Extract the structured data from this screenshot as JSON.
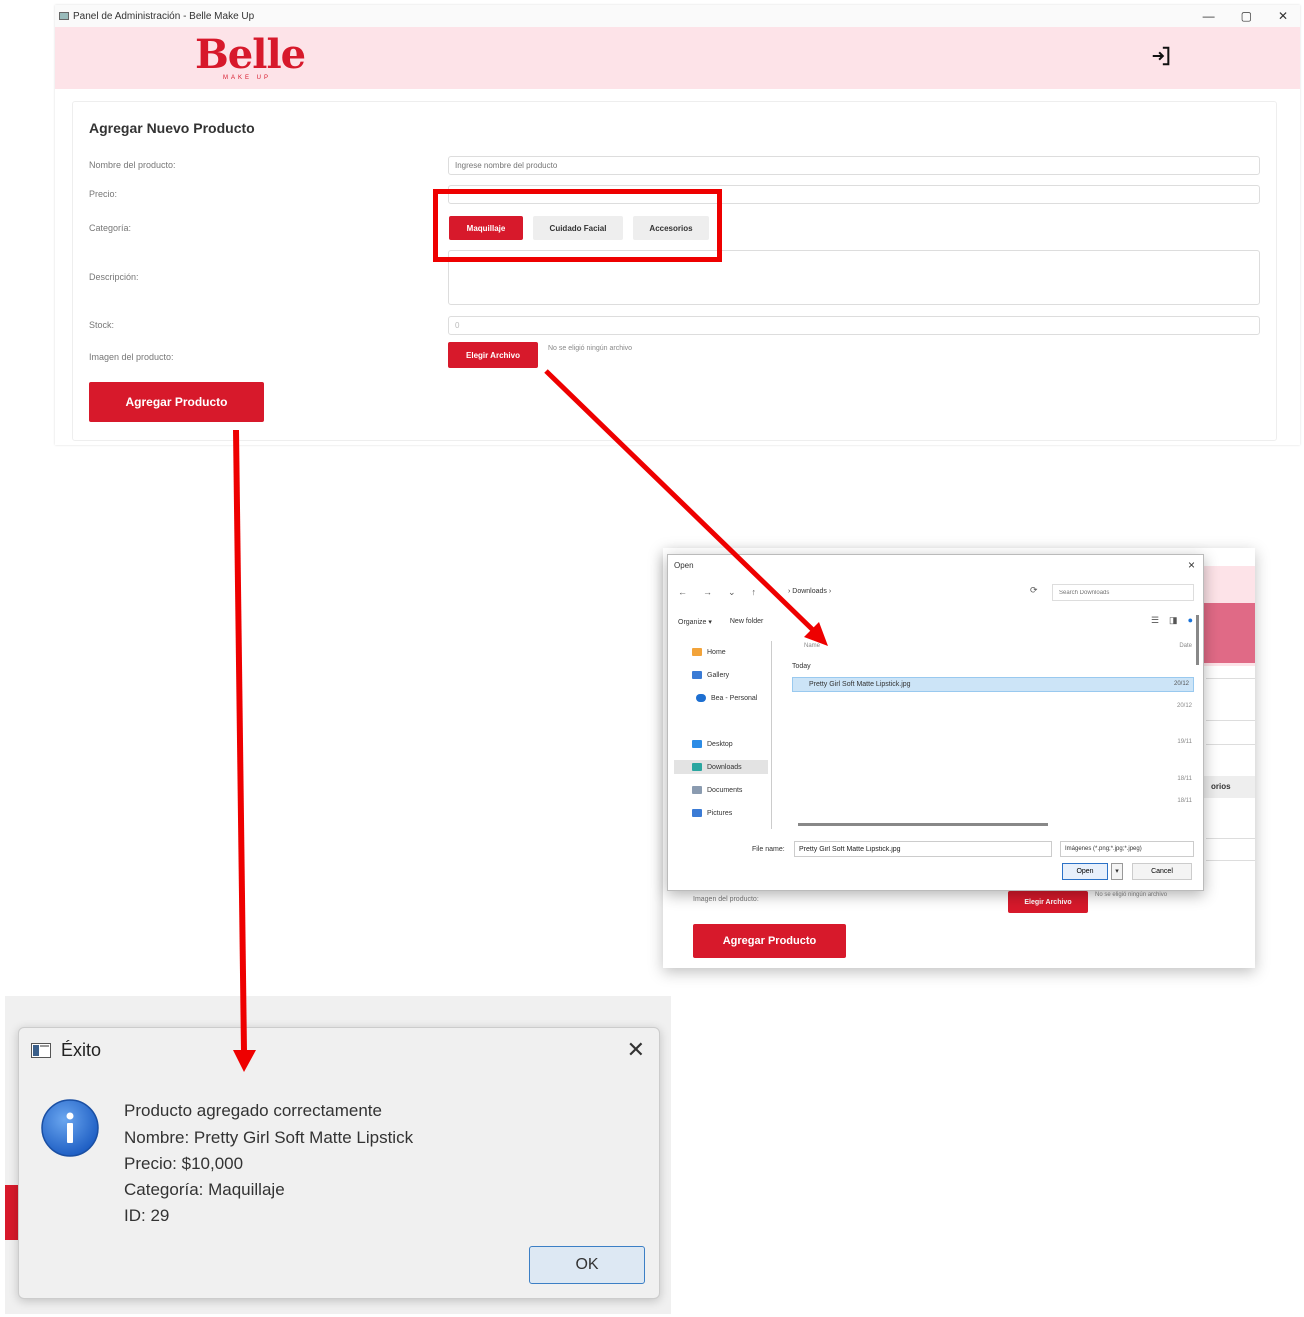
{
  "main_window": {
    "title": "Panel de Administración - Belle Make Up",
    "controls": {
      "minimize": "—",
      "maximize": "▢",
      "close": "✕"
    },
    "logo": {
      "wordmark": "Belle",
      "subtitle": "MAKE UP"
    },
    "form": {
      "title": "Agregar Nuevo Producto",
      "labels": {
        "name": "Nombre del producto:",
        "price": "Precio:",
        "category": "Categoría:",
        "description": "Descripción:",
        "stock": "Stock:",
        "image": "Imagen del producto:"
      },
      "name_placeholder": "Ingrese nombre del producto",
      "stock_value": "0",
      "categories": [
        "Maquillaje",
        "Cuidado Facial",
        "Accesorios"
      ],
      "selected_category": "Maquillaje",
      "choose_file_label": "Elegir Archivo",
      "no_file_text": "No se eligió ningún archivo",
      "submit_label": "Agregar Producto"
    }
  },
  "background_shot": {
    "image_label": "Imagen del producto:",
    "choose_file_label": "Elegir Archivo",
    "no_file_text": "No se eligió ningún archivo",
    "submit_label": "Agregar Producto",
    "category_fragment": "orios"
  },
  "open_dialog": {
    "title": "Open",
    "path": "›  Downloads  ›",
    "search_placeholder": "Search Downloads",
    "toolbar": {
      "organize": "Organize ▾",
      "new_folder": "New folder"
    },
    "sidebar": [
      "Home",
      "Gallery",
      "Bea - Personal",
      "Desktop",
      "Downloads",
      "Documents",
      "Pictures"
    ],
    "columns": {
      "name": "Name",
      "date": "Date"
    },
    "group": "Today",
    "file_name": "Pretty Girl Soft Matte Lipstick.jpg",
    "file_date": "20/12",
    "other_dates": [
      "20/12",
      "19/11",
      "18/11",
      "18/11"
    ],
    "file_name_label": "File name:",
    "file_name_value": "Pretty Girl Soft Matte Lipstick.jpg",
    "filter": "Imágenes (*.png;*.jpg;*.jpeg)",
    "open_label": "Open",
    "cancel_label": "Cancel"
  },
  "success_dialog": {
    "title": "Éxito",
    "lines": [
      "Producto agregado correctamente",
      "Nombre: Pretty Girl Soft Matte Lipstick",
      "Precio: $10,000",
      "Categoría: Maquillaje",
      "ID: 29"
    ],
    "ok_label": "OK"
  },
  "colors": {
    "brand_red": "#d7192b",
    "header_pink": "#fde3e8",
    "annotation_red": "#ee0000"
  }
}
